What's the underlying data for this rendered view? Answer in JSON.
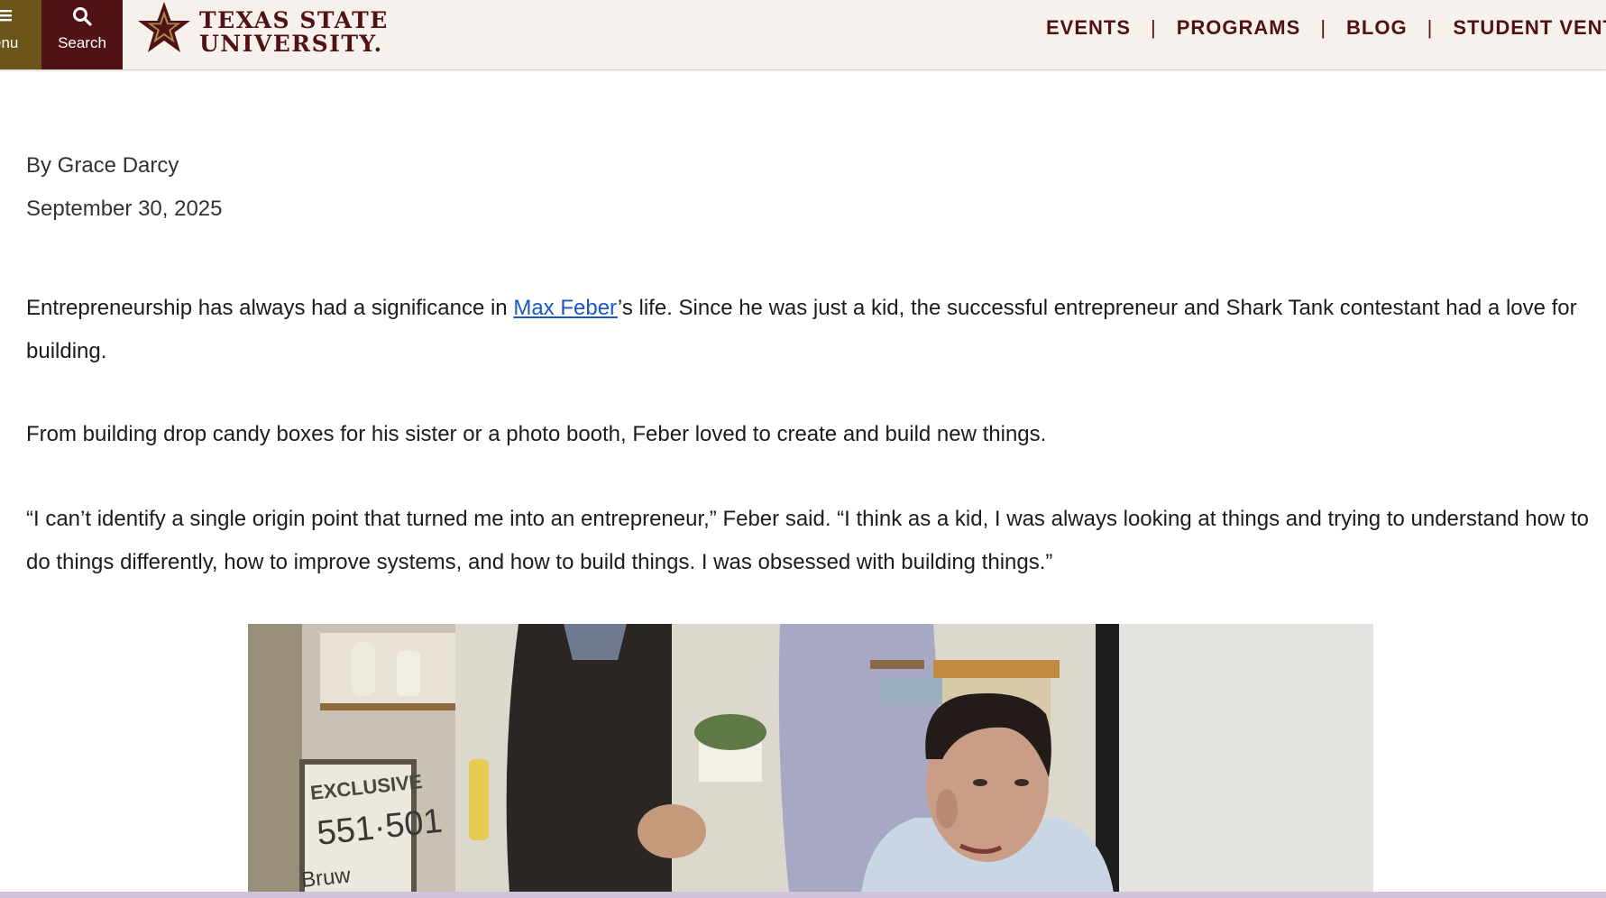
{
  "header": {
    "menu_label": "enu",
    "search_label": "Search",
    "logo_line1": "TEXAS STATE",
    "logo_line2": "UNIVERSITY.",
    "nav": [
      "EVENTS",
      "PROGRAMS",
      "BLOG",
      "STUDENT VENTU"
    ],
    "separator": "|"
  },
  "article": {
    "byline": "By Grace Darcy",
    "date": "September 30, 2025",
    "p1_before": "Entrepreneurship has always had a significance in ",
    "p1_link": "Max Feber",
    "p1_after": "’s life. Since he was just a kid, the successful entrepreneur and Shark Tank contestant had a love for building.",
    "p2": "From building drop candy boxes for his sister or a photo booth, Feber loved to create and build new things.",
    "p3": "“I can’t identify a single origin point that turned me into an entrepreneur,” Feber said. “I think as a kid, I was always looking at things and trying to understand how to do things differently, how to improve systems, and how to build things. I was obsessed with building things.”"
  },
  "photo": {
    "sign_line1": "EXCLUSIVE",
    "sign_line2": "551·501",
    "sign_line3": "Bruw"
  },
  "colors": {
    "maroon": "#501214",
    "gold": "#6b5518",
    "link": "#1a57c4",
    "header_bg": "#f6f1ec"
  }
}
